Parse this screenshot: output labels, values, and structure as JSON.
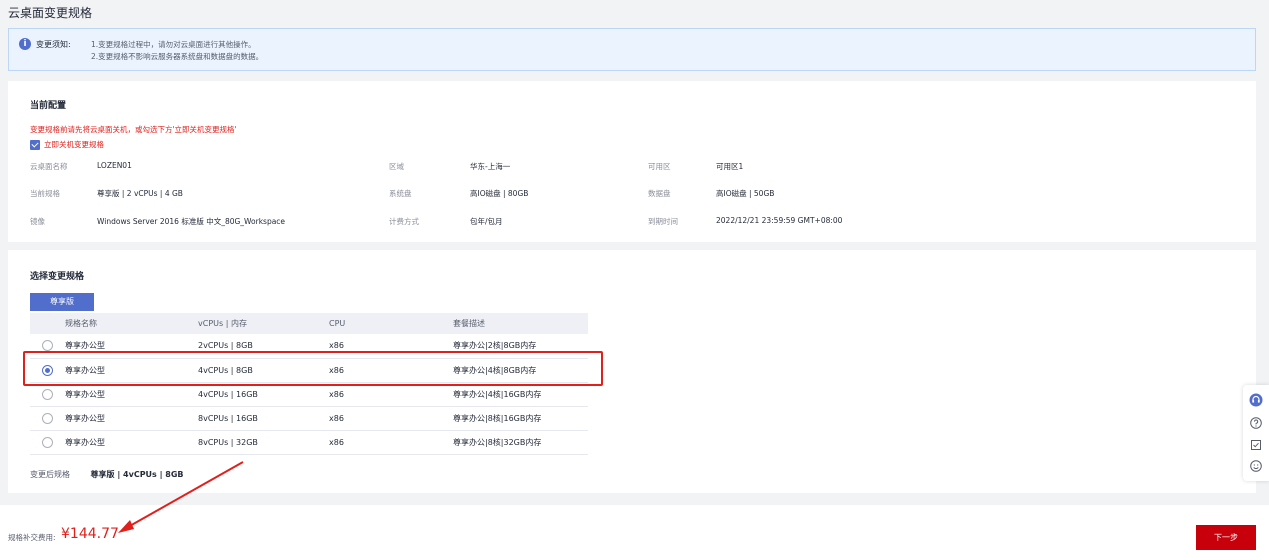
{
  "page": {
    "title": "云桌面变更规格"
  },
  "notice": {
    "label": "变更须知:",
    "lines": [
      "1.变更规格过程中，请勿对云桌面进行其他操作。",
      "2.变更规格不影响云服务器系统盘和数据盘的数据。"
    ]
  },
  "current": {
    "title": "当前配置",
    "warning": "变更规格前请先将云桌面关机，或勾选下方'立即关机变更规格'",
    "checkbox_label": "立即关机变更规格",
    "checkbox_checked": true,
    "fields": {
      "name": {
        "label": "云桌面名称",
        "value": "LOZEN01"
      },
      "region": {
        "label": "区域",
        "value": "华东-上海一"
      },
      "az": {
        "label": "可用区",
        "value": "可用区1"
      },
      "spec": {
        "label": "当前规格",
        "value": "尊享版 | 2 vCPUs | 4 GB"
      },
      "sysdisk": {
        "label": "系统盘",
        "value": "高IO磁盘 | 80GB"
      },
      "datadisk": {
        "label": "数据盘",
        "value": "高IO磁盘 | 50GB"
      },
      "image": {
        "label": "镜像",
        "value": "Windows Server 2016 标准版 中文_80G_Workspace"
      },
      "billing": {
        "label": "计费方式",
        "value": "包年/包月"
      },
      "expire": {
        "label": "到期时间",
        "value": "2022/12/21 23:59:59 GMT+08:00"
      }
    }
  },
  "select": {
    "title": "选择变更规格",
    "tab": "尊享版",
    "columns": [
      "规格名称",
      "vCPUs | 内存",
      "CPU",
      "套餐描述"
    ],
    "rows": [
      {
        "name": "尊享办公型",
        "vcpu": "2vCPUs | 8GB",
        "cpu": "x86",
        "desc": "尊享办公|2核|8GB内存",
        "selected": false
      },
      {
        "name": "尊享办公型",
        "vcpu": "4vCPUs | 8GB",
        "cpu": "x86",
        "desc": "尊享办公|4核|8GB内存",
        "selected": true
      },
      {
        "name": "尊享办公型",
        "vcpu": "4vCPUs | 16GB",
        "cpu": "x86",
        "desc": "尊享办公|4核|16GB内存",
        "selected": false
      },
      {
        "name": "尊享办公型",
        "vcpu": "8vCPUs | 16GB",
        "cpu": "x86",
        "desc": "尊享办公|8核|16GB内存",
        "selected": false
      },
      {
        "name": "尊享办公型",
        "vcpu": "8vCPUs | 32GB",
        "cpu": "x86",
        "desc": "尊享办公|8核|32GB内存",
        "selected": false
      }
    ],
    "after_label": "变更后规格",
    "after_value": "尊享版 | 4vCPUs | 8GB"
  },
  "footer": {
    "fee_label": "规格补交费用:",
    "fee_value": "¥144.77",
    "next_label": "下一步"
  },
  "sidebar_icons": [
    "headset-icon",
    "help-icon",
    "feedback-icon",
    "smiley-icon"
  ],
  "colors": {
    "accent": "#526ecc",
    "danger": "#e1201c",
    "primary_button": "#c7000b"
  }
}
